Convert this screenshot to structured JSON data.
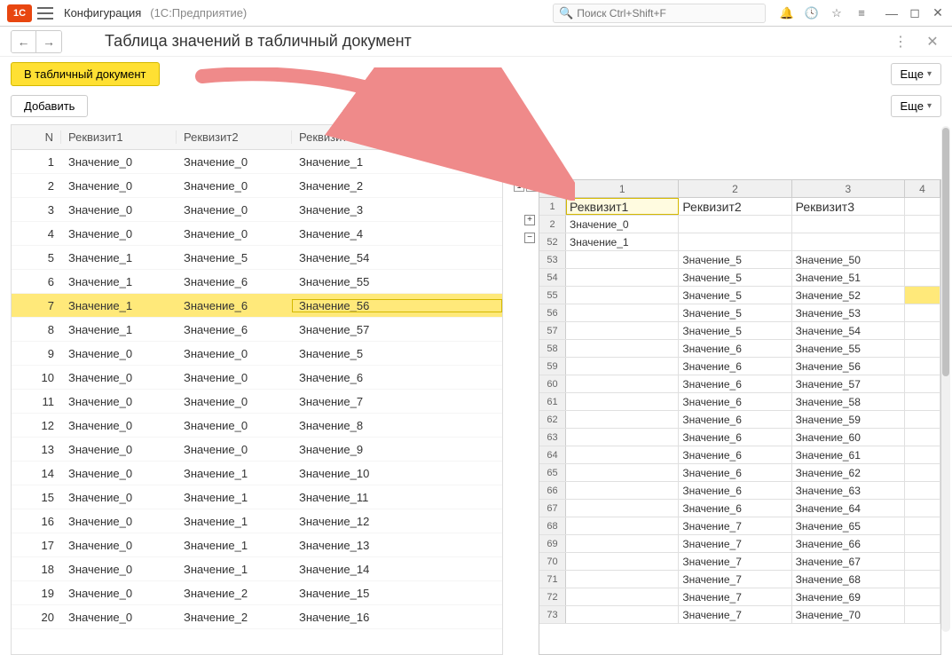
{
  "topbar": {
    "title": "Конфигурация",
    "subtitle": "(1С:Предприятие)",
    "search_placeholder": "Поиск Ctrl+Shift+F"
  },
  "header": {
    "title": "Таблица значений в табличный документ"
  },
  "buttons": {
    "to_doc": "В табличный документ",
    "more": "Еще",
    "add": "Добавить"
  },
  "left_table": {
    "headers": [
      "N",
      "Реквизит1",
      "Реквизит2",
      "Реквизит3"
    ],
    "rows": [
      {
        "n": 1,
        "r1": "Значение_0",
        "r2": "Значение_0",
        "r3": "Значение_1"
      },
      {
        "n": 2,
        "r1": "Значение_0",
        "r2": "Значение_0",
        "r3": "Значение_2"
      },
      {
        "n": 3,
        "r1": "Значение_0",
        "r2": "Значение_0",
        "r3": "Значение_3"
      },
      {
        "n": 4,
        "r1": "Значение_0",
        "r2": "Значение_0",
        "r3": "Значение_4"
      },
      {
        "n": 5,
        "r1": "Значение_1",
        "r2": "Значение_5",
        "r3": "Значение_54"
      },
      {
        "n": 6,
        "r1": "Значение_1",
        "r2": "Значение_6",
        "r3": "Значение_55"
      },
      {
        "n": 7,
        "r1": "Значение_1",
        "r2": "Значение_6",
        "r3": "Значение_56",
        "sel": true
      },
      {
        "n": 8,
        "r1": "Значение_1",
        "r2": "Значение_6",
        "r3": "Значение_57"
      },
      {
        "n": 9,
        "r1": "Значение_0",
        "r2": "Значение_0",
        "r3": "Значение_5"
      },
      {
        "n": 10,
        "r1": "Значение_0",
        "r2": "Значение_0",
        "r3": "Значение_6"
      },
      {
        "n": 11,
        "r1": "Значение_0",
        "r2": "Значение_0",
        "r3": "Значение_7"
      },
      {
        "n": 12,
        "r1": "Значение_0",
        "r2": "Значение_0",
        "r3": "Значение_8"
      },
      {
        "n": 13,
        "r1": "Значение_0",
        "r2": "Значение_0",
        "r3": "Значение_9"
      },
      {
        "n": 14,
        "r1": "Значение_0",
        "r2": "Значение_1",
        "r3": "Значение_10"
      },
      {
        "n": 15,
        "r1": "Значение_0",
        "r2": "Значение_1",
        "r3": "Значение_11"
      },
      {
        "n": 16,
        "r1": "Значение_0",
        "r2": "Значение_1",
        "r3": "Значение_12"
      },
      {
        "n": 17,
        "r1": "Значение_0",
        "r2": "Значение_1",
        "r3": "Значение_13"
      },
      {
        "n": 18,
        "r1": "Значение_0",
        "r2": "Значение_1",
        "r3": "Значение_14"
      },
      {
        "n": 19,
        "r1": "Значение_0",
        "r2": "Значение_2",
        "r3": "Значение_15"
      },
      {
        "n": 20,
        "r1": "Значение_0",
        "r2": "Значение_2",
        "r3": "Значение_16"
      }
    ]
  },
  "sheet": {
    "col_heads": [
      "1",
      "2",
      "3",
      "4"
    ],
    "label_row": {
      "rowh": "1",
      "cells": [
        "Реквизит1",
        "Реквизит2",
        "Реквизит3",
        ""
      ]
    },
    "rows": [
      {
        "rowh": "2",
        "c1": "Значение_0",
        "c2": "",
        "c3": "",
        "c4": ""
      },
      {
        "rowh": "52",
        "c1": "Значение_1",
        "c2": "",
        "c3": "",
        "c4": ""
      },
      {
        "rowh": "53",
        "c1": "",
        "c2": "Значение_5",
        "c3": "Значение_50",
        "c4": ""
      },
      {
        "rowh": "54",
        "c1": "",
        "c2": "Значение_5",
        "c3": "Значение_51",
        "c4": ""
      },
      {
        "rowh": "55",
        "c1": "",
        "c2": "Значение_5",
        "c3": "Значение_52",
        "c4": "",
        "sel4": true
      },
      {
        "rowh": "56",
        "c1": "",
        "c2": "Значение_5",
        "c3": "Значение_53",
        "c4": ""
      },
      {
        "rowh": "57",
        "c1": "",
        "c2": "Значение_5",
        "c3": "Значение_54",
        "c4": ""
      },
      {
        "rowh": "58",
        "c1": "",
        "c2": "Значение_6",
        "c3": "Значение_55",
        "c4": ""
      },
      {
        "rowh": "59",
        "c1": "",
        "c2": "Значение_6",
        "c3": "Значение_56",
        "c4": ""
      },
      {
        "rowh": "60",
        "c1": "",
        "c2": "Значение_6",
        "c3": "Значение_57",
        "c4": ""
      },
      {
        "rowh": "61",
        "c1": "",
        "c2": "Значение_6",
        "c3": "Значение_58",
        "c4": ""
      },
      {
        "rowh": "62",
        "c1": "",
        "c2": "Значение_6",
        "c3": "Значение_59",
        "c4": ""
      },
      {
        "rowh": "63",
        "c1": "",
        "c2": "Значение_6",
        "c3": "Значение_60",
        "c4": ""
      },
      {
        "rowh": "64",
        "c1": "",
        "c2": "Значение_6",
        "c3": "Значение_61",
        "c4": ""
      },
      {
        "rowh": "65",
        "c1": "",
        "c2": "Значение_6",
        "c3": "Значение_62",
        "c4": ""
      },
      {
        "rowh": "66",
        "c1": "",
        "c2": "Значение_6",
        "c3": "Значение_63",
        "c4": ""
      },
      {
        "rowh": "67",
        "c1": "",
        "c2": "Значение_6",
        "c3": "Значение_64",
        "c4": ""
      },
      {
        "rowh": "68",
        "c1": "",
        "c2": "Значение_7",
        "c3": "Значение_65",
        "c4": ""
      },
      {
        "rowh": "69",
        "c1": "",
        "c2": "Значение_7",
        "c3": "Значение_66",
        "c4": ""
      },
      {
        "rowh": "70",
        "c1": "",
        "c2": "Значение_7",
        "c3": "Значение_67",
        "c4": ""
      },
      {
        "rowh": "71",
        "c1": "",
        "c2": "Значение_7",
        "c3": "Значение_68",
        "c4": ""
      },
      {
        "rowh": "72",
        "c1": "",
        "c2": "Значение_7",
        "c3": "Значение_69",
        "c4": ""
      },
      {
        "rowh": "73",
        "c1": "",
        "c2": "Значение_7",
        "c3": "Значение_70",
        "c4": ""
      }
    ]
  }
}
